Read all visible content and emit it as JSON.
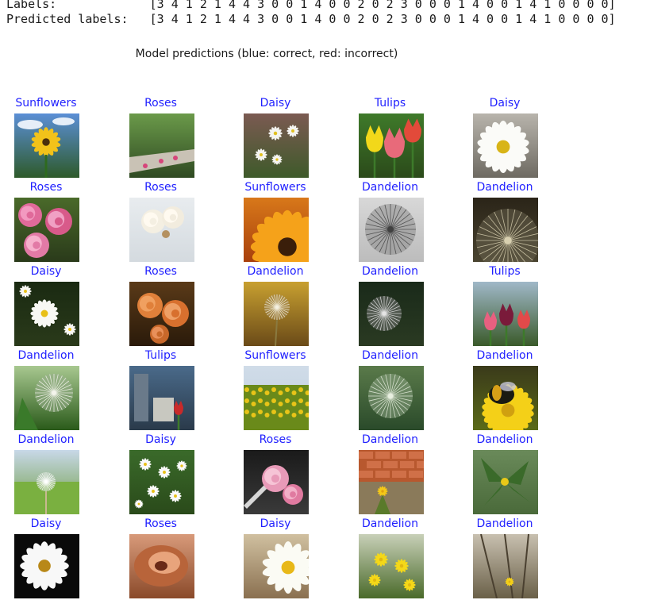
{
  "console": {
    "labels_line": "Labels:             [3 4 1 2 1 4 4 3 0 0 1 4 0 0 2 0 2 3 0 0 0 1 4 0 0 1 4 1 0 0 0 0]",
    "predicted_line": "Predicted labels:   [3 4 1 2 1 4 4 3 0 0 1 4 0 0 2 0 2 3 0 0 0 1 4 0 0 1 4 1 0 0 0 0]"
  },
  "figure": {
    "title": "Model predictions (blue: correct, red: incorrect)",
    "correct_color": "#1f1fff",
    "incorrect_color": "#e01010",
    "cells": [
      {
        "label": "Sunflowers",
        "correct": true,
        "image": "sunflower-sky-photo"
      },
      {
        "label": "Roses",
        "correct": true,
        "image": "rose-garden-path-photo"
      },
      {
        "label": "Daisy",
        "correct": true,
        "image": "daisy-field-photo"
      },
      {
        "label": "Tulips",
        "correct": true,
        "image": "tulips-closeup-photo"
      },
      {
        "label": "Daisy",
        "correct": true,
        "image": "daisy-closeup-photo"
      },
      {
        "label": "Roses",
        "correct": true,
        "image": "pink-roses-photo"
      },
      {
        "label": "Roses",
        "correct": true,
        "image": "white-roses-photo"
      },
      {
        "label": "Sunflowers",
        "correct": true,
        "image": "sunflower-closeup-photo"
      },
      {
        "label": "Dandelion",
        "correct": true,
        "image": "dandelion-seedhead-bw-photo"
      },
      {
        "label": "Dandelion",
        "correct": true,
        "image": "dandelion-dark-photo"
      },
      {
        "label": "Daisy",
        "correct": true,
        "image": "daisies-dark-photo"
      },
      {
        "label": "Roses",
        "correct": true,
        "image": "orange-roses-photo"
      },
      {
        "label": "Dandelion",
        "correct": true,
        "image": "dandelion-seedhead-gold-photo"
      },
      {
        "label": "Dandelion",
        "correct": true,
        "image": "dandelion-seedhead-dark-photo"
      },
      {
        "label": "Tulips",
        "correct": true,
        "image": "tulips-garden-photo"
      },
      {
        "label": "Dandelion",
        "correct": true,
        "image": "dandelion-green-photo"
      },
      {
        "label": "Tulips",
        "correct": true,
        "image": "tulips-street-photo"
      },
      {
        "label": "Sunflowers",
        "correct": true,
        "image": "sunflower-field-photo"
      },
      {
        "label": "Dandelion",
        "correct": true,
        "image": "dandelion-seedhead-green-photo"
      },
      {
        "label": "Dandelion",
        "correct": true,
        "image": "bee-on-dandelion-photo"
      },
      {
        "label": "Dandelion",
        "correct": true,
        "image": "dandelion-meadow-photo"
      },
      {
        "label": "Daisy",
        "correct": true,
        "image": "daisies-green-photo"
      },
      {
        "label": "Roses",
        "correct": true,
        "image": "pink-roses-dark-photo"
      },
      {
        "label": "Dandelion",
        "correct": true,
        "image": "dandelion-brick-wall-photo"
      },
      {
        "label": "Dandelion",
        "correct": true,
        "image": "dandelion-leaves-photo"
      },
      {
        "label": "Daisy",
        "correct": true,
        "image": "white-daisy-black-photo"
      },
      {
        "label": "Roses",
        "correct": true,
        "image": "rose-blur-photo"
      },
      {
        "label": "Daisy",
        "correct": true,
        "image": "daisy-blur-photo"
      },
      {
        "label": "Dandelion",
        "correct": true,
        "image": "dandelions-yellow-photo"
      },
      {
        "label": "Dandelion",
        "correct": true,
        "image": "dandelion-branches-photo"
      }
    ]
  }
}
